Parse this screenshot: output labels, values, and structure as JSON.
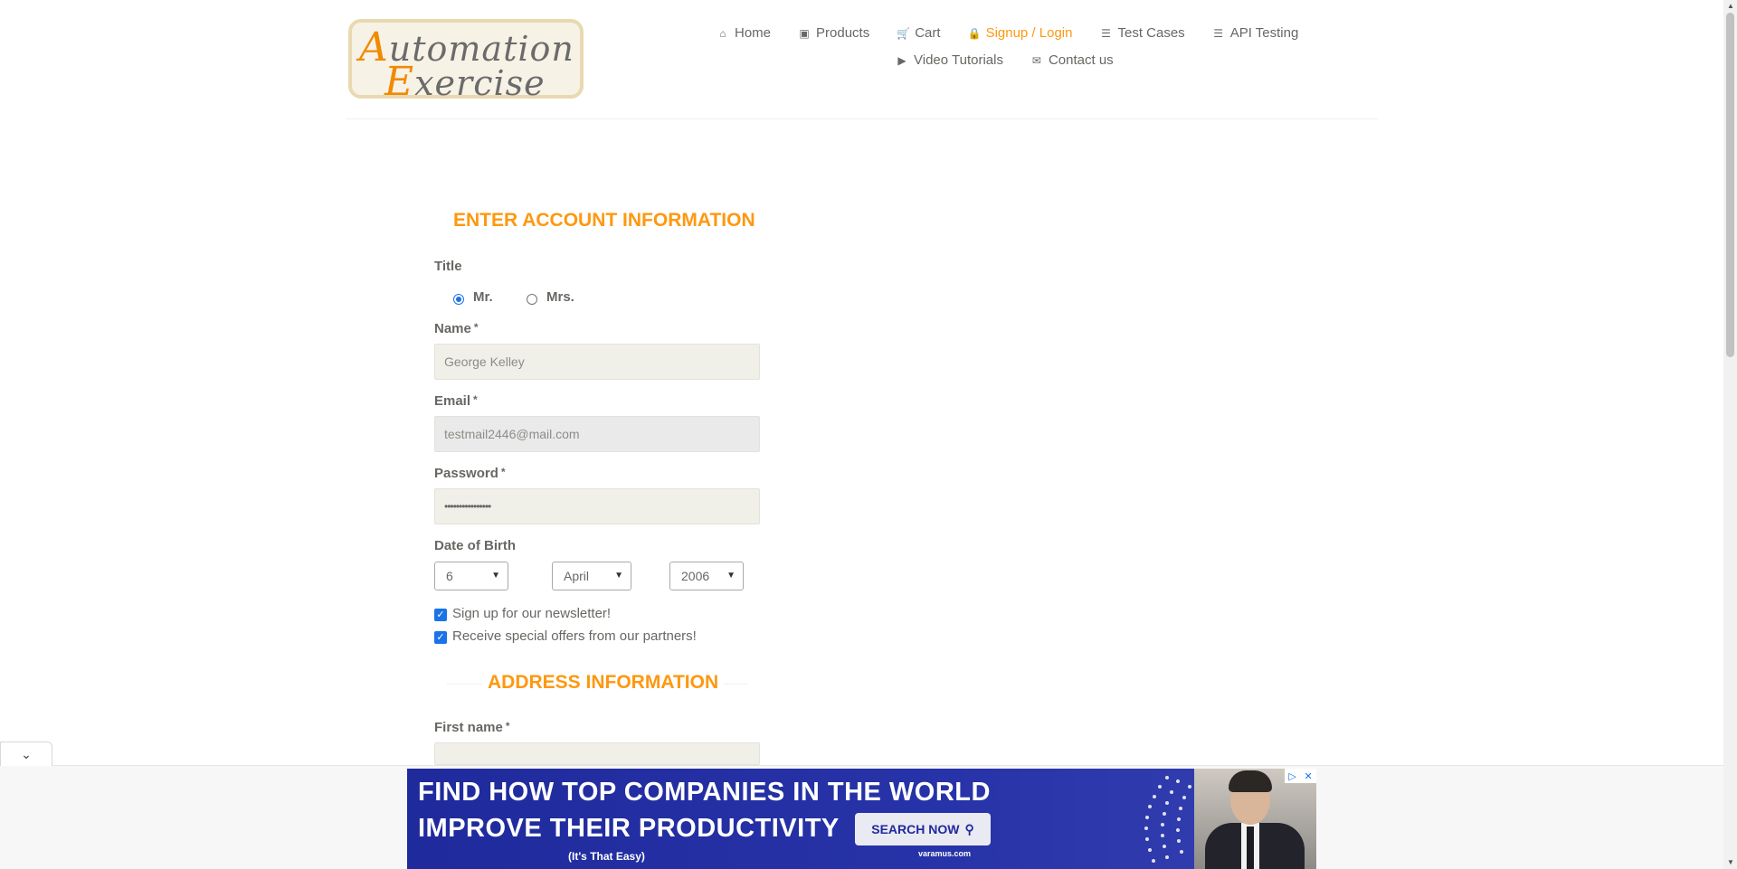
{
  "logo": {
    "line1_cap": "A",
    "line1_rest": "utomation",
    "line2_cap": "E",
    "line2_rest": "xercise"
  },
  "nav": {
    "items": [
      {
        "label": "Home",
        "icon": "home-icon"
      },
      {
        "label": "Products",
        "icon": "briefcase-icon"
      },
      {
        "label": "Cart",
        "icon": "cart-icon"
      },
      {
        "label": "Signup / Login",
        "icon": "lock-icon",
        "active": true
      },
      {
        "label": "Test Cases",
        "icon": "list-icon"
      },
      {
        "label": "API Testing",
        "icon": "list-icon"
      },
      {
        "label": "Video Tutorials",
        "icon": "youtube-play-icon"
      },
      {
        "label": "Contact us",
        "icon": "envelope-icon"
      }
    ]
  },
  "account": {
    "heading": "ENTER ACCOUNT INFORMATION",
    "title_label": "Title",
    "title_options": [
      "Mr.",
      "Mrs."
    ],
    "title_selected": "Mr.",
    "name_label": "Name",
    "name_value": "George Kelley",
    "email_label": "Email",
    "email_value": "testmail2446@mail.com",
    "password_label": "Password",
    "password_value": "••••••••••••••••",
    "dob_label": "Date of Birth",
    "dob_day": "6",
    "dob_month": "April",
    "dob_year": "2006",
    "newsletter_label": "Sign up for our newsletter!",
    "offers_label": "Receive special offers from our partners!",
    "required_mark": "*"
  },
  "address": {
    "heading": "ADDRESS INFORMATION",
    "first_name_label": "First name"
  },
  "ad": {
    "line1": "FIND HOW TOP COMPANIES IN THE WORLD",
    "line2": "IMPROVE THEIR PRODUCTIVITY",
    "button": "SEARCH NOW",
    "tagline": "(It's That Easy)",
    "brand": "varamus.com"
  },
  "colors": {
    "accent": "#fe980f",
    "text": "#696763",
    "input_bg": "#f0f0e9",
    "ad_bg": "#1f2a9c"
  }
}
